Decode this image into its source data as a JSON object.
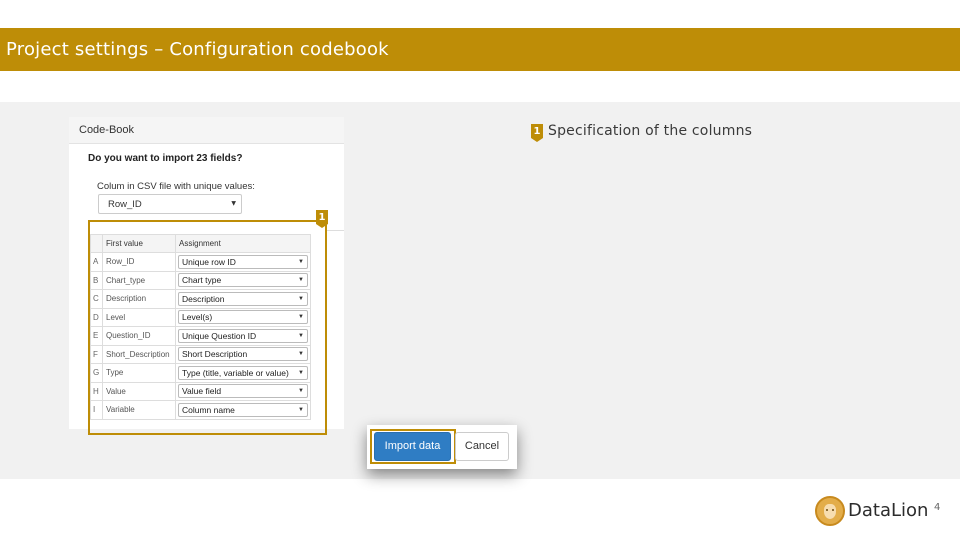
{
  "slide": {
    "title": "Project settings – Configuration codebook",
    "page_number": "4",
    "brand": "DataLion",
    "accent_color": "#be8d07"
  },
  "dialog": {
    "header": "Code-Book",
    "question": "Do you want to import 23 fields?",
    "unique_label": "Colum in CSV file with unique values:",
    "unique_value": "Row_ID",
    "table": {
      "headers": [
        "",
        "First value",
        "Assignment"
      ],
      "rows": [
        {
          "letter": "A",
          "first": "Row_ID",
          "assignment": "Unique row ID"
        },
        {
          "letter": "B",
          "first": "Chart_type",
          "assignment": "Chart type"
        },
        {
          "letter": "C",
          "first": "Description",
          "assignment": "Description"
        },
        {
          "letter": "D",
          "first": "Level",
          "assignment": "Level(s)"
        },
        {
          "letter": "E",
          "first": "Question_ID",
          "assignment": "Unique Question ID"
        },
        {
          "letter": "F",
          "first": "Short_Description",
          "assignment": "Short Description"
        },
        {
          "letter": "G",
          "first": "Type",
          "assignment": "Type (title, variable or value)"
        },
        {
          "letter": "H",
          "first": "Value",
          "assignment": "Value field"
        },
        {
          "letter": "I",
          "first": "Variable",
          "assignment": "Column name"
        }
      ]
    },
    "import_label": "Import data",
    "cancel_label": "Cancel",
    "import_color": "#2f7dc4"
  },
  "annotations": {
    "marker_number": "1",
    "legend_text": "Specification of the columns"
  },
  "icons": {
    "select_caret": "chevron-down-icon",
    "logo": "lion-logo-icon"
  }
}
